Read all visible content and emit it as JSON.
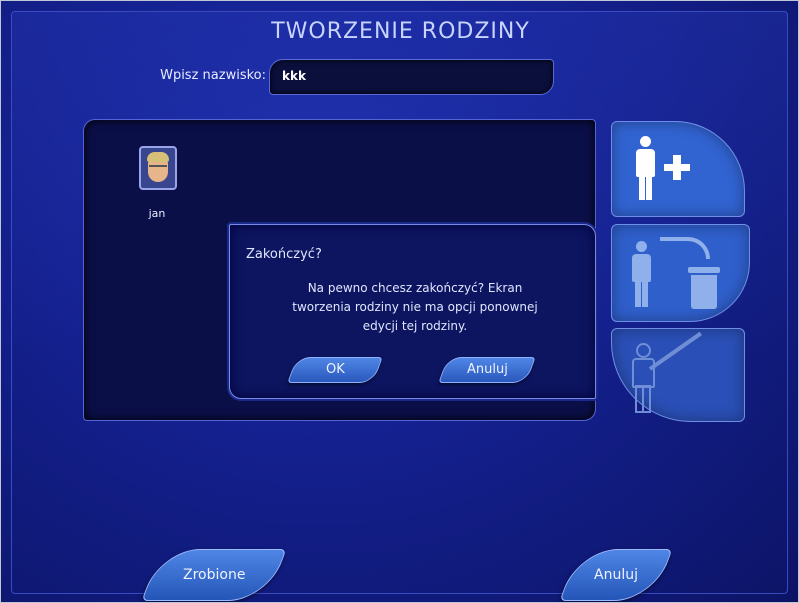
{
  "title": "TWORZENIE RODZINY",
  "surname": {
    "label": "Wpisz nazwisko:",
    "value": "kkk"
  },
  "members": [
    {
      "name": "jan"
    }
  ],
  "side_buttons": [
    {
      "icon": "add-person-icon"
    },
    {
      "icon": "delete-person-icon"
    },
    {
      "icon": "edit-person-icon"
    }
  ],
  "dialog": {
    "title": "Zakończyć?",
    "message": "Na pewno chcesz zakończyć? Ekran\ntworzenia rodziny nie ma opcji ponownej\nedycji tej rodziny.",
    "ok_label": "OK",
    "cancel_label": "Anuluj"
  },
  "bottom": {
    "done_label": "Zrobione",
    "cancel_label": "Anuluj"
  },
  "colors": {
    "background": "#14208e",
    "panel": "#0b0f48",
    "button": "#2d58c8",
    "text": "#e0e6ff"
  }
}
